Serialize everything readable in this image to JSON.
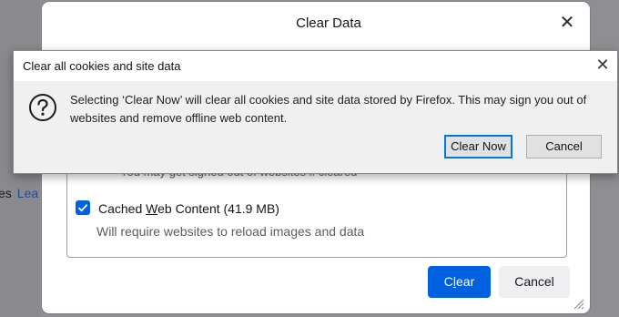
{
  "background": {
    "text": "es",
    "link": "Lea"
  },
  "clear_data_dialog": {
    "title": "Clear Data",
    "close_glyph": "✕",
    "partial_text": "You may get signed out of websites if cleared",
    "cached_content": {
      "checked": true,
      "label_pre": "Cached ",
      "label_mnemonic": "W",
      "label_post": "eb Content (41.9 MB)",
      "description": "Will require websites to reload images and data"
    },
    "buttons": {
      "clear_pre": "C",
      "clear_mnemonic": "l",
      "clear_post": "ear",
      "cancel": "Cancel"
    }
  },
  "confirm_dialog": {
    "title": "Clear all cookies and site data",
    "close_glyph": "✕",
    "icon": "question-icon",
    "message": "Selecting ‘Clear Now’ will clear all cookies and site data stored by Firefox. This may sign you out of websites and remove offline web content.",
    "buttons": {
      "clear_now": "Clear Now",
      "cancel": "Cancel"
    }
  },
  "colors": {
    "accent": "#0061e0",
    "confirm_focus": "#0078d7"
  }
}
